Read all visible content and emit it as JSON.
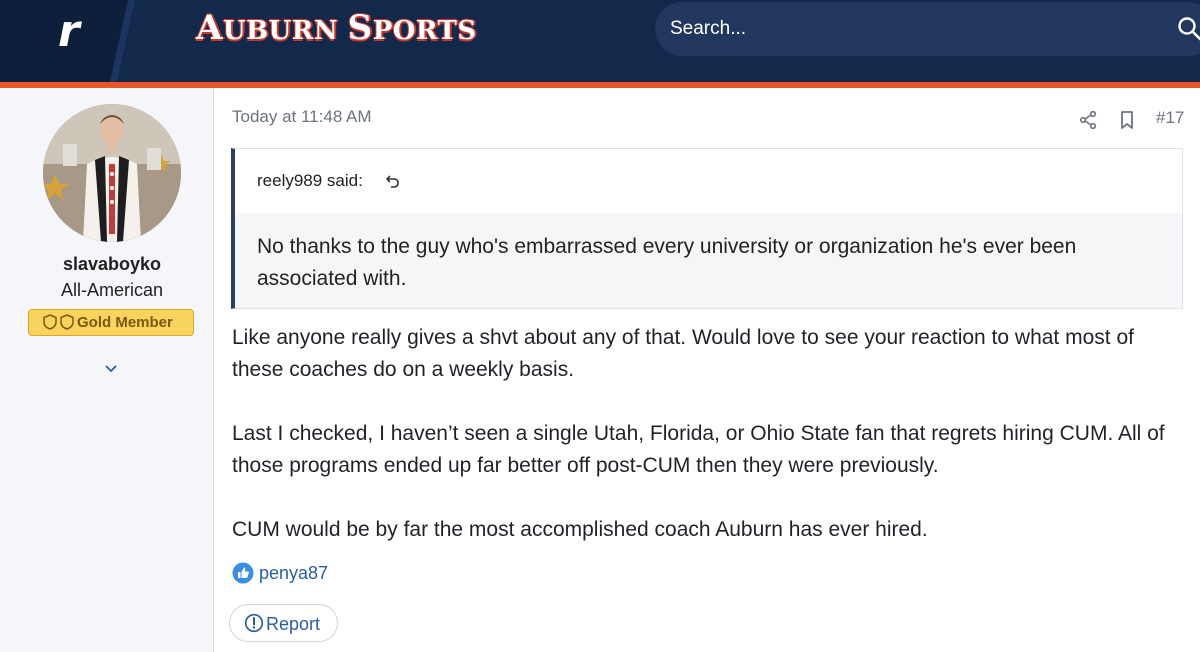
{
  "header": {
    "logo_letter": "r",
    "site_title_parts": [
      {
        "text": "A",
        "small": false
      },
      {
        "text": "UBURN ",
        "small": true
      },
      {
        "text": "S",
        "small": false
      },
      {
        "text": "PORTS",
        "small": true
      }
    ],
    "search_placeholder": "Search..."
  },
  "user": {
    "username": "slavaboyko",
    "title": "All-American",
    "badge": "Gold Member"
  },
  "post": {
    "date": "Today at 11:48 AM",
    "number": "#17",
    "quote": {
      "author": "reely989 said:",
      "text": "No thanks to the guy who's embarrassed every university or organization he's ever been associated with."
    },
    "paragraphs": [
      "Like anyone really gives a shvt about any of that. Would love to see your reaction to what most of these coaches do on a weekly basis.",
      "Last I checked, I haven’t seen a single Utah, Florida, or Ohio State fan that regrets hiring CUM. All of those programs ended up far better off post-CUM then they were previously.",
      "CUM would be by far the most accomplished coach Auburn has ever hired."
    ],
    "reaction_user": "penya87",
    "report_label": "Report"
  },
  "colors": {
    "header_bg": "#13294b",
    "accent_orange": "#e8562a",
    "link_blue": "#2a5ea0",
    "badge_gold": "#f8d35d"
  }
}
